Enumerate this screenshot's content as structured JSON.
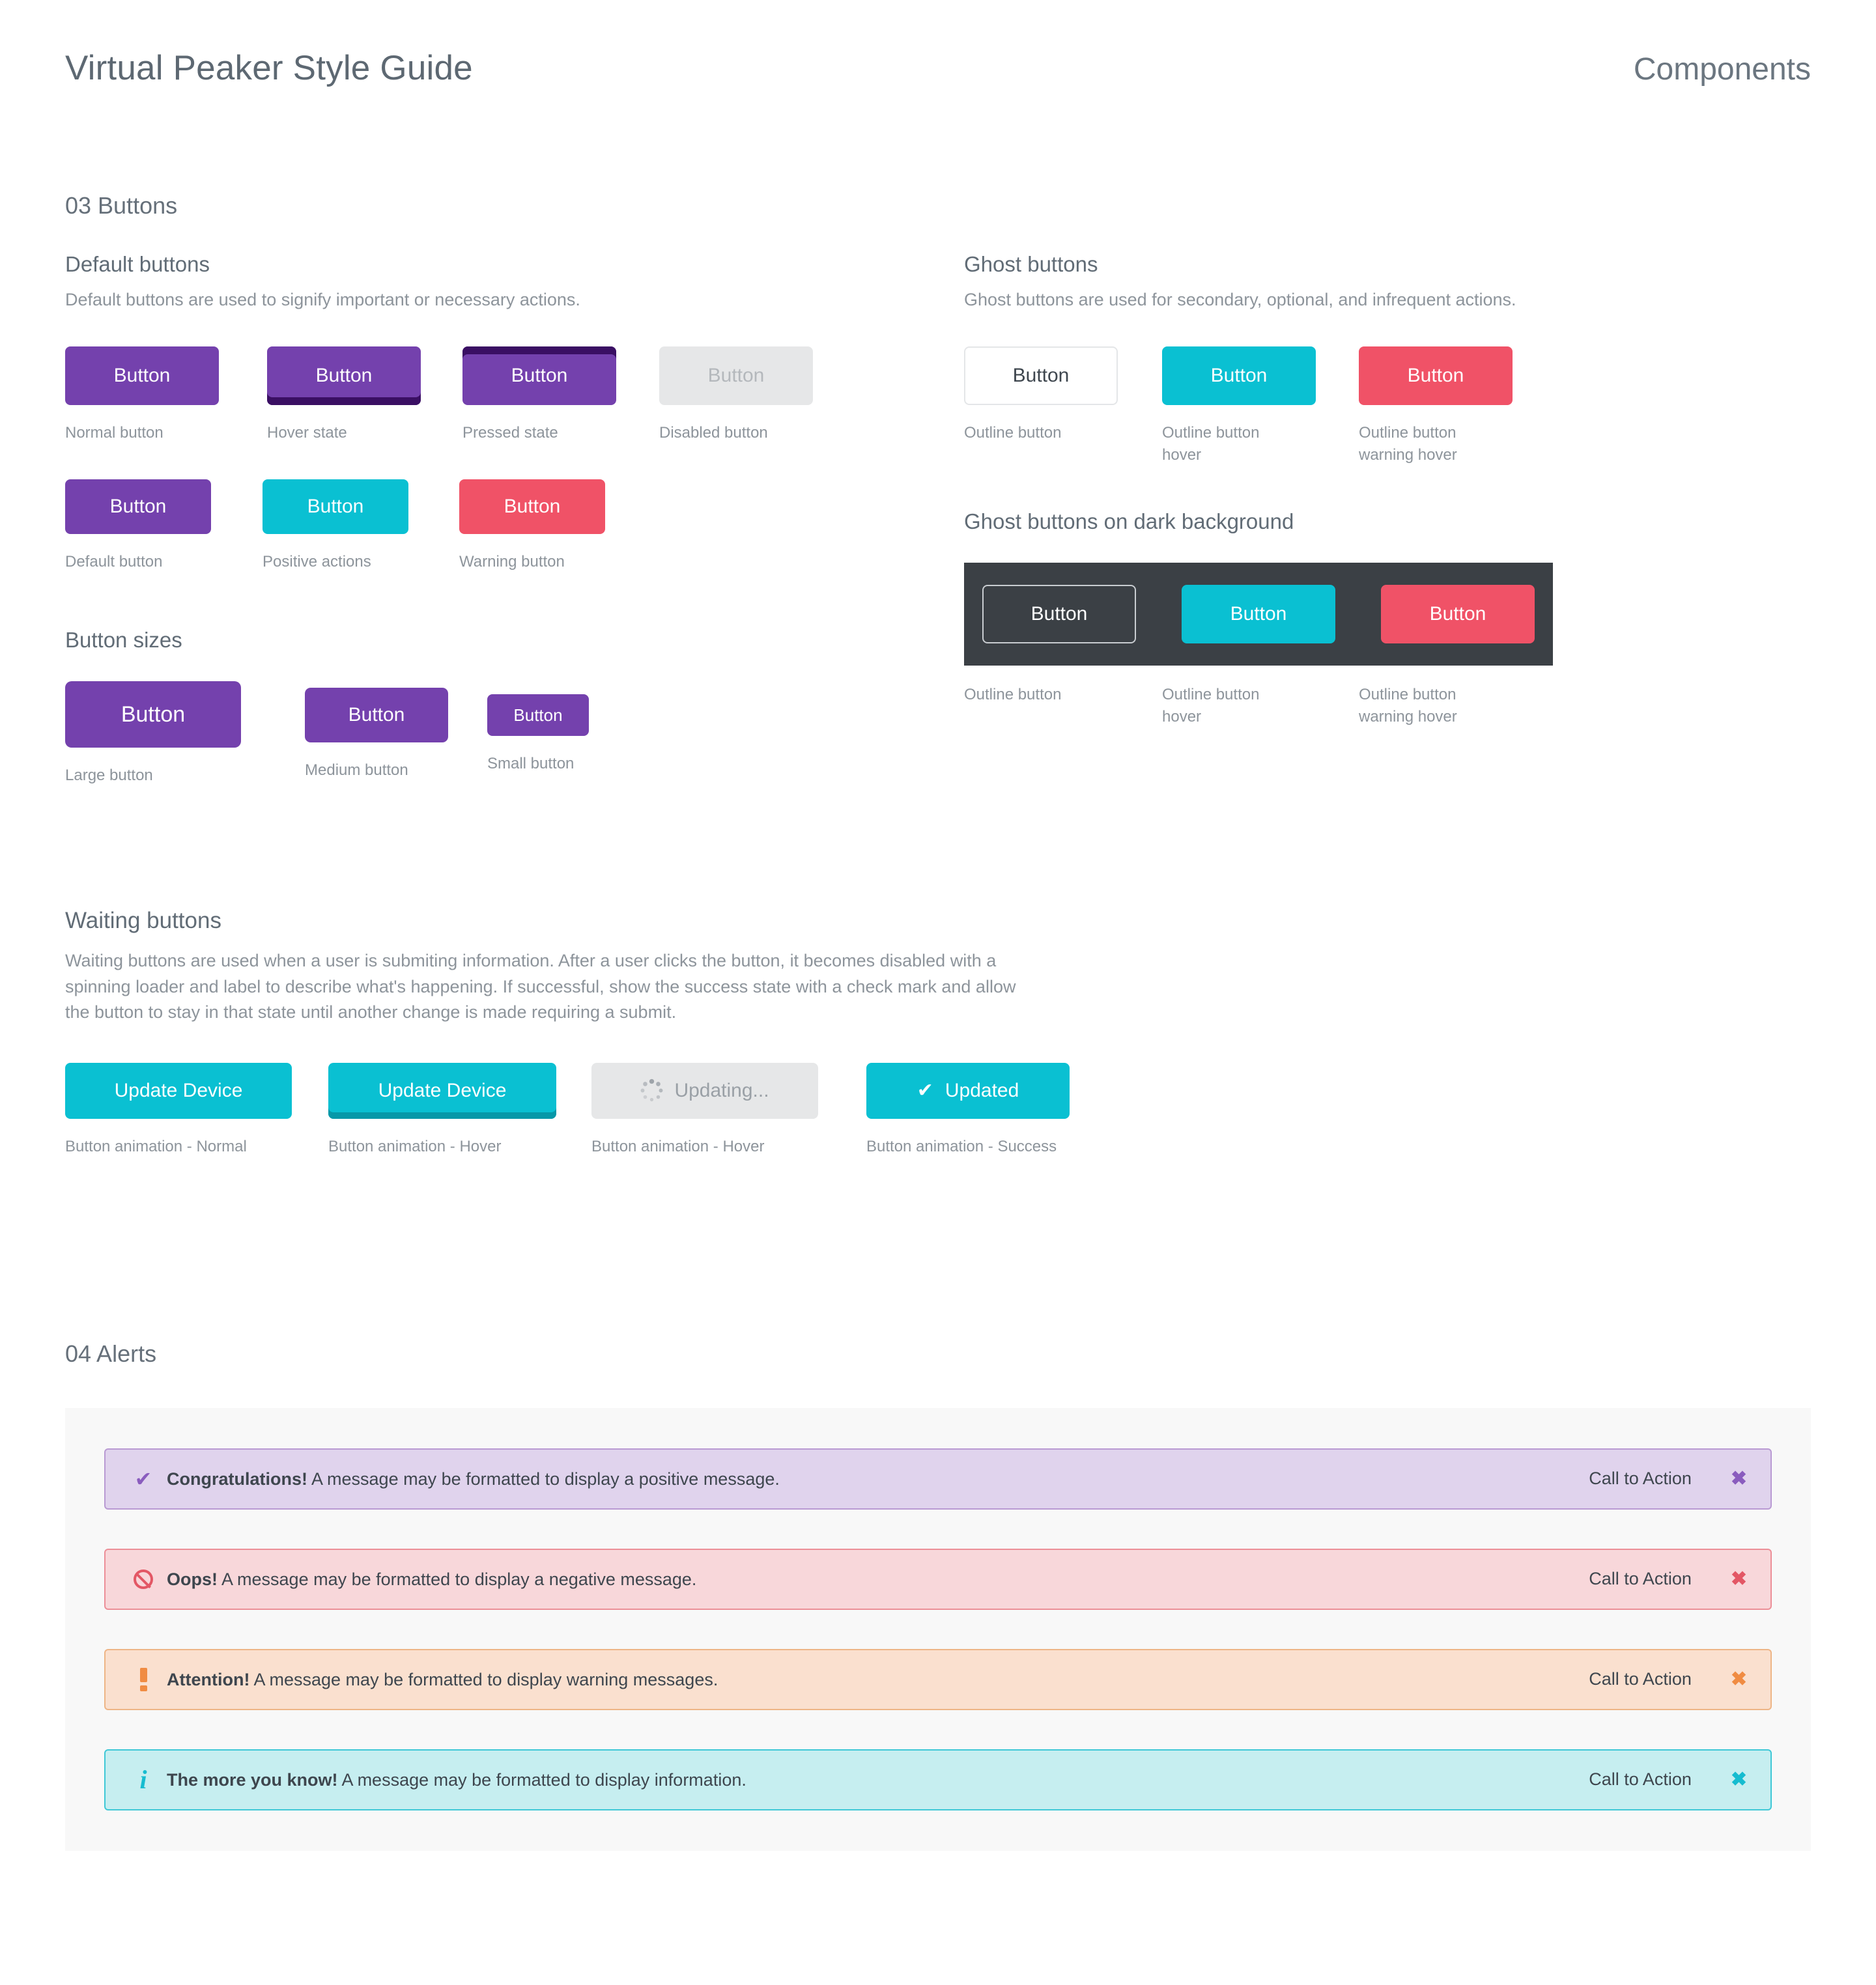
{
  "header": {
    "title": "Virtual Peaker Style Guide",
    "section_name": "Components"
  },
  "buttons_section": {
    "number_label": "03 Buttons",
    "default": {
      "heading": "Default buttons",
      "description": "Default buttons are used to signify important or necessary actions.",
      "row1": [
        {
          "label": "Button",
          "caption": "Normal button",
          "color": "#7441ad"
        },
        {
          "label": "Button",
          "caption": "Hover state",
          "color": "#7441ad"
        },
        {
          "label": "Button",
          "caption": "Pressed state",
          "color": "#7441ad"
        },
        {
          "label": "Button",
          "caption": "Disabled button",
          "color": "#e6e7e8"
        }
      ],
      "row2": [
        {
          "label": "Button",
          "caption": "Default button",
          "color": "#7441ad"
        },
        {
          "label": "Button",
          "caption": "Positive actions",
          "color": "#0ac0d2"
        },
        {
          "label": "Button",
          "caption": "Warning button",
          "color": "#f05267"
        }
      ]
    },
    "sizes": {
      "heading": "Button sizes",
      "items": [
        {
          "label": "Button",
          "caption": "Large button"
        },
        {
          "label": "Button",
          "caption": "Medium button"
        },
        {
          "label": "Button",
          "caption": "Small button"
        }
      ]
    },
    "ghost": {
      "heading": "Ghost buttons",
      "description": "Ghost buttons are used for secondary, optional, and infrequent actions.",
      "items": [
        {
          "label": "Button",
          "caption": "Outline button"
        },
        {
          "label": "Button",
          "caption": "Outline button hover"
        },
        {
          "label": "Button",
          "caption": "Outline button warning hover"
        }
      ]
    },
    "ghost_dark": {
      "heading": "Ghost buttons on dark background",
      "background": "#3b4045",
      "items": [
        {
          "label": "Button",
          "caption": "Outline button"
        },
        {
          "label": "Button",
          "caption": "Outline button hover"
        },
        {
          "label": "Button",
          "caption": "Outline button warning hover"
        }
      ]
    },
    "waiting": {
      "heading": "Waiting buttons",
      "description": "Waiting buttons are used when a user is submiting information. After a user clicks the button, it becomes disabled with a spinning loader and label to describe what's happening. If successful, show the success state with a check mark and allow the button to stay in that state until another change is made requiring a submit.",
      "items": [
        {
          "label": "Update Device",
          "caption": "Button animation - Normal",
          "icon": "none"
        },
        {
          "label": "Update Device",
          "caption": "Button animation - Hover",
          "icon": "none"
        },
        {
          "label": "Updating...",
          "caption": "Button animation - Hover",
          "icon": "spinner-icon"
        },
        {
          "label": "Updated",
          "caption": "Button animation - Success",
          "icon": "check-icon"
        }
      ]
    }
  },
  "alerts_section": {
    "number_label": "04 Alerts",
    "items": [
      {
        "icon": "check-icon",
        "bold": "Congratulations!",
        "text": " A message may be formatted to display a positive message.",
        "cta": "Call to Action",
        "close": "✖",
        "accent": "#8a5cbe"
      },
      {
        "icon": "ban-icon",
        "bold": "Oops!",
        "text": " A message may be formatted to display a negative message.",
        "cta": "Call to Action",
        "close": "✖",
        "accent": "#e35765"
      },
      {
        "icon": "exclamation-icon",
        "bold": "Attention!",
        "text": " A message may be formatted to display warning messages.",
        "cta": "Call to Action",
        "close": "✖",
        "accent": "#f08c43"
      },
      {
        "icon": "info-icon",
        "bold": "The more you know!",
        "text": " A message may be formatted to display information.",
        "cta": "Call to Action",
        "close": "✖",
        "accent": "#16bcd0"
      }
    ]
  }
}
